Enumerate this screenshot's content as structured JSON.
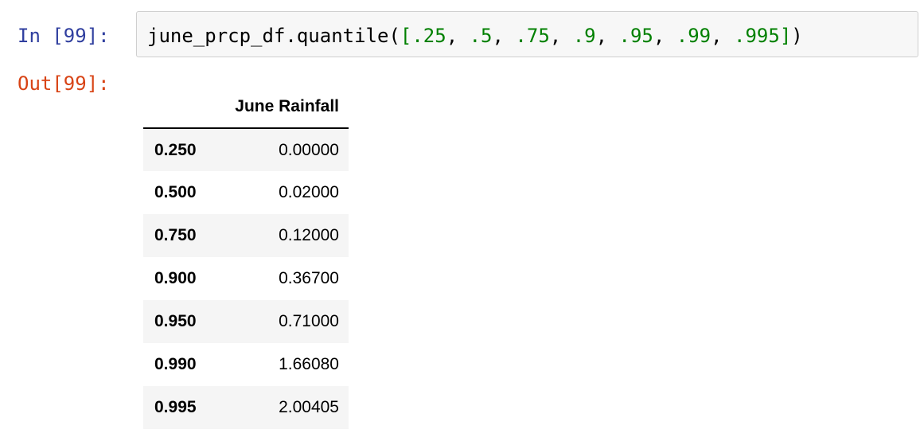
{
  "input_prompt": "In [99]:",
  "code": {
    "tokens": [
      {
        "text": "june_prcp_df",
        "kind": "plain"
      },
      {
        "text": ".",
        "kind": "plain"
      },
      {
        "text": "quantile",
        "kind": "plain"
      },
      {
        "text": "(",
        "kind": "plain"
      },
      {
        "text": "[",
        "kind": "bracket"
      },
      {
        "text": ".25",
        "kind": "num"
      },
      {
        "text": ", ",
        "kind": "plain"
      },
      {
        "text": ".5",
        "kind": "num"
      },
      {
        "text": ", ",
        "kind": "plain"
      },
      {
        "text": ".75",
        "kind": "num"
      },
      {
        "text": ", ",
        "kind": "plain"
      },
      {
        "text": ".9",
        "kind": "num"
      },
      {
        "text": ", ",
        "kind": "plain"
      },
      {
        "text": ".95",
        "kind": "num"
      },
      {
        "text": ", ",
        "kind": "plain"
      },
      {
        "text": ".99",
        "kind": "num"
      },
      {
        "text": ", ",
        "kind": "plain"
      },
      {
        "text": ".995",
        "kind": "num"
      },
      {
        "text": "]",
        "kind": "bracket"
      },
      {
        "text": ")",
        "kind": "plain"
      }
    ]
  },
  "output_prompt": "Out[99]:",
  "dataframe": {
    "index_header": "",
    "column_header": "June Rainfall",
    "rows": [
      {
        "index": "0.250",
        "value": "0.00000"
      },
      {
        "index": "0.500",
        "value": "0.02000"
      },
      {
        "index": "0.750",
        "value": "0.12000"
      },
      {
        "index": "0.900",
        "value": "0.36700"
      },
      {
        "index": "0.950",
        "value": "0.71000"
      },
      {
        "index": "0.990",
        "value": "1.66080"
      },
      {
        "index": "0.995",
        "value": "2.00405"
      }
    ]
  },
  "colors": {
    "input_prompt": "#303f9f",
    "output_prompt": "#d84315",
    "number_literal": "#008000",
    "input_background": "#f7f7f7",
    "input_border": "#cfcfcf",
    "striped_row": "#f5f5f5"
  }
}
